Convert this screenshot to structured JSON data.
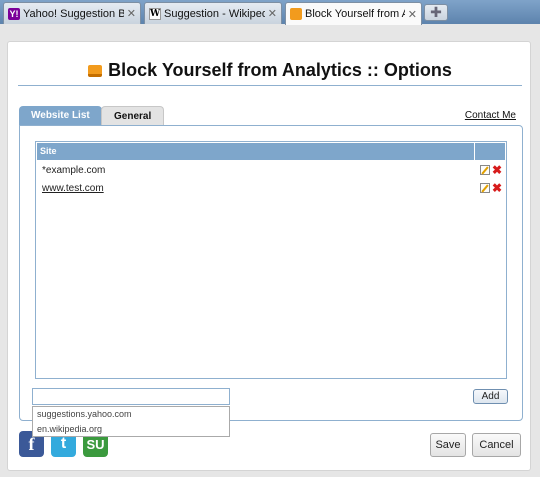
{
  "browser": {
    "tabs": [
      {
        "title": "Yahoo! Suggestion Boa...",
        "favicon": "yahoo-icon",
        "active": false
      },
      {
        "title": "Suggestion - Wikipedia...",
        "favicon": "wikipedia-icon",
        "active": false
      },
      {
        "title": "Block Yourself from An...",
        "favicon": "analytics-icon",
        "active": true
      }
    ],
    "new_tab_glyph": "✚",
    "close_glyph": "✕"
  },
  "page": {
    "title": "Block Yourself from Analytics :: Options",
    "tabs": [
      "Website List",
      "General"
    ],
    "contact": "Contact Me",
    "table": {
      "header": "Site",
      "rows": [
        {
          "site": "*example.com",
          "underlined": false
        },
        {
          "site": "www.test.com",
          "underlined": true
        }
      ]
    },
    "add_input_value": "",
    "add_button": "Add",
    "suggestions": [
      "suggestions.yahoo.com",
      "en.wikipedia.org"
    ],
    "social": [
      "facebook-icon",
      "twitter-icon",
      "stumbleupon-icon"
    ],
    "save_button": "Save",
    "cancel_button": "Cancel"
  }
}
